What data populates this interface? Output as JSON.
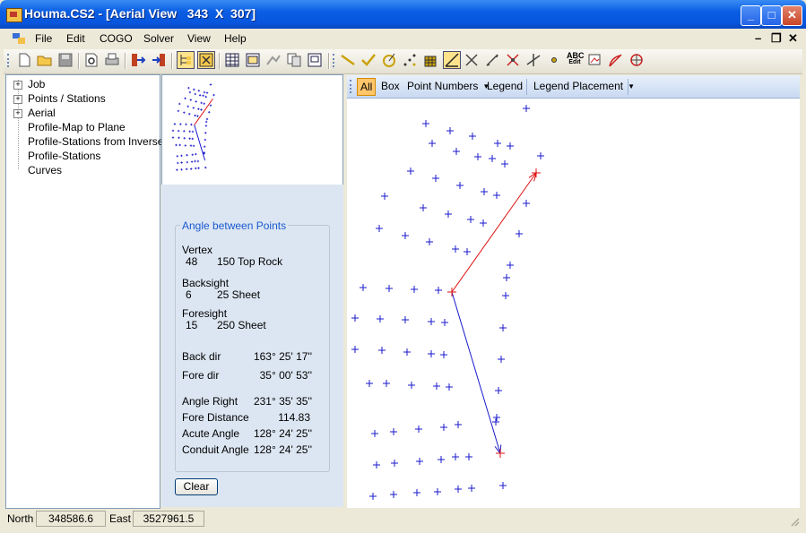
{
  "window": {
    "title": "Houma.CS2 - [Aerial View   343  X  307]",
    "min": "_",
    "max": "□",
    "close": "✕"
  },
  "menu": {
    "items": [
      "File",
      "Edit",
      "COGO",
      "Solver",
      "View",
      "Help"
    ],
    "mdi_min": "–",
    "mdi_restore": "❐",
    "mdi_close": "✕"
  },
  "toolbar": {
    "icons": [
      "new-file",
      "open-folder",
      "save",
      "print-preview",
      "print",
      "import",
      "export",
      "tree-view",
      "aerial-view",
      "table-grid",
      "window",
      "draw-lines",
      "copy",
      "screen",
      "line-tool",
      "check-tool",
      "cogo-tool",
      "point-tool",
      "grid-tool",
      "angle-tool",
      "cross-tool",
      "dimension-tool",
      "intersect-tool",
      "perpendicular-tool",
      "point-marker",
      "abc-edit",
      "image-edit",
      "curve-tool",
      "circle-tool"
    ],
    "abc_label": "ABC",
    "edit_label": "Edit"
  },
  "tree": {
    "items": [
      {
        "label": "Job",
        "expandable": true
      },
      {
        "label": "Points / Stations",
        "expandable": true
      },
      {
        "label": "Aerial",
        "expandable": true
      },
      {
        "label": "Profile-Map to Plane",
        "expandable": false
      },
      {
        "label": "Profile-Stations from Inverse",
        "expandable": false
      },
      {
        "label": "Profile-Stations",
        "expandable": false
      },
      {
        "label": "Curves",
        "expandable": false
      }
    ]
  },
  "angle": {
    "title": "Angle between Points",
    "vertex_label": "Vertex",
    "vertex_num": "48",
    "vertex_desc": "150 Top Rock",
    "backsight_label": "Backsight",
    "backsight_num": "6",
    "backsight_desc": "25 Sheet",
    "foresight_label": "Foresight",
    "foresight_num": "15",
    "foresight_desc": "250 Sheet",
    "back_dir_label": "Back dir",
    "back_dir": "163° 25' 17''",
    "fore_dir_label": "Fore dir",
    "fore_dir": "35° 00' 53''",
    "angle_right_label": "Angle Right",
    "angle_right": "231° 35' 35''",
    "fore_distance_label": "Fore Distance",
    "fore_distance": "114.83",
    "acute_label": "Acute Angle",
    "acute": "128° 24' 25''",
    "conduit_label": "Conduit Angle",
    "conduit": "128° 24' 25''",
    "clear_label": "Clear"
  },
  "aerial_toolbar": {
    "all": "All",
    "box": "Box",
    "point_numbers": "Point Numbers",
    "legend": "Legend",
    "legend_placement": "Legend Placement"
  },
  "status": {
    "north_label": "North",
    "north_value": "348586.6",
    "east_label": "East",
    "east_value": "3527961.5"
  },
  "colors": {
    "point": "#1a1acc",
    "backsight_line": "#e01010",
    "foresight_line": "#1a1acc",
    "panel": "#dce6f2",
    "group_title": "#1a5ad0"
  }
}
